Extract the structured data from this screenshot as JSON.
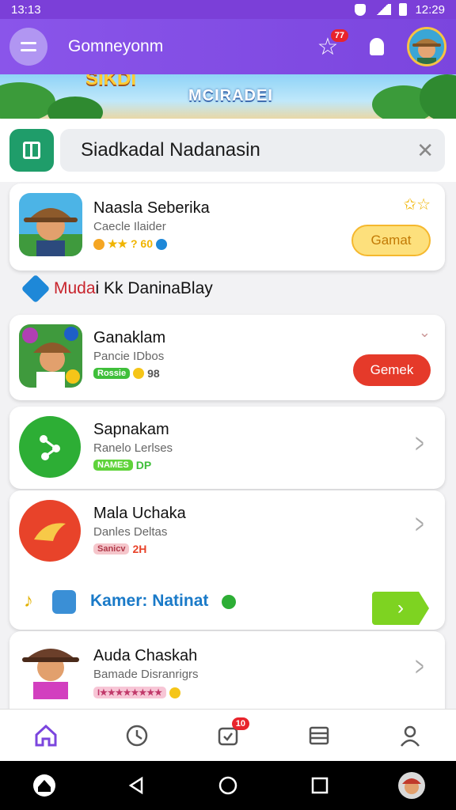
{
  "status_bar": {
    "time_left": "13:13",
    "time_right": "12:29"
  },
  "app_bar": {
    "title": "Gomneyonm",
    "notification_count": "77"
  },
  "banner": {
    "logo_text": "SIKDI",
    "text": "MCIRADEI"
  },
  "search": {
    "value": "Siadkadal Nadanasin"
  },
  "cards": [
    {
      "name": "Naasla Seberika",
      "subtitle": "Caecle Ilaider",
      "meta": "★★ ? 60",
      "action": "Gamat"
    },
    {
      "name": "Ganaklam",
      "subtitle": "Pancie IDbos",
      "meta_pill": "Rossie",
      "meta": "98",
      "action": "Gemek"
    },
    {
      "name": "Sapnakam",
      "subtitle": "Ranelo Lerlses",
      "meta_pill": "NAMES",
      "meta": "DP"
    },
    {
      "name": "Mala Uchaka",
      "subtitle": "Danles Deltas",
      "meta_pill": "Sanicv",
      "meta": "2H"
    },
    {
      "name": "Auda Chaskah",
      "subtitle": "Bamade Disranrigrs",
      "meta_pill": "I★★★★★★★★"
    }
  ],
  "section": {
    "title_red": "Muda",
    "title_rest": "i Kk DaninaBlay"
  },
  "promo": {
    "text": "Kamer: Natinat"
  },
  "bottom_nav": {
    "badge": "10"
  },
  "colors": {
    "primary": "#7b45de",
    "accent_green": "#1f9d6a",
    "red": "#e53a2a"
  }
}
